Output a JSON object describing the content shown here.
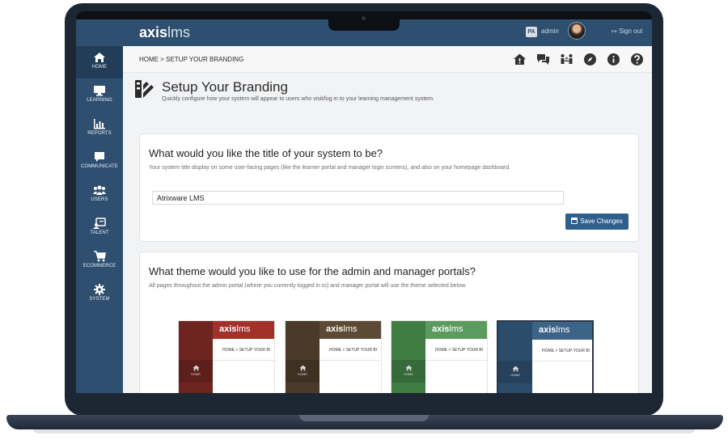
{
  "app": {
    "logo_bold": "axis",
    "logo_light": "lms",
    "user_initials": "PA",
    "user_name": "admin",
    "signout_label": "Sign out"
  },
  "sidebar": {
    "items": [
      {
        "label": "HOME",
        "icon": "home-icon",
        "active": true
      },
      {
        "label": "LEARNING",
        "icon": "monitor-icon"
      },
      {
        "label": "REPORTS",
        "icon": "bar-chart-icon"
      },
      {
        "label": "COMMUNICATE",
        "icon": "speech-bubble-icon"
      },
      {
        "label": "USERS",
        "icon": "users-icon"
      },
      {
        "label": "TALENT",
        "icon": "talent-icon"
      },
      {
        "label": "ECOMMERCE",
        "icon": "cart-icon"
      },
      {
        "label": "SYSTEM",
        "icon": "gear-icon"
      }
    ]
  },
  "breadcrumb": "HOME > SETUP YOUR BRANDING",
  "toolbar_icons": [
    "home-alert-icon",
    "chat-icon",
    "network-icon",
    "compass-icon",
    "info-icon",
    "help-icon"
  ],
  "page": {
    "title": "Setup Your Branding",
    "subtitle": "Quickly configure how your system will appear to users who visit/log in to your learning management system."
  },
  "title_section": {
    "heading": "What would you like the title of your system to be?",
    "description": "Your system title display on some user-facing pages (like the learner portal and manager login screens), and also on your homepage dashboard.",
    "input_value": "Atrixware LMS",
    "save_label": "Save Changes"
  },
  "theme_section": {
    "heading": "What theme would you like to use for the admin and manager portals?",
    "description": "All pages throughout the admin portal (where you currently logged in to) and manager portal will use the theme selected below.",
    "themes": [
      {
        "name": "red",
        "header": "#a2312a",
        "side": "#6e2520",
        "crumb": "HOME > SETUP YOUR BI",
        "home": "HOME",
        "selected": false
      },
      {
        "name": "brown",
        "header": "#5d4a34",
        "side": "#4a3a28",
        "crumb": "HOME > SETUP YOUR BI",
        "home": "HOME",
        "selected": false
      },
      {
        "name": "green",
        "header": "#5c9b5e",
        "side": "#3f7d42",
        "crumb": "HOME > SETUP YOUR BI",
        "home": "HOME",
        "selected": false
      },
      {
        "name": "blue",
        "header": "#3c6388",
        "side": "#2c4c6b",
        "crumb": "HOME > SETUP YOUR BI",
        "home": "HOME",
        "selected": true
      }
    ]
  },
  "colors": {
    "brand": "#2e4f6f",
    "button": "#2f5f8c"
  }
}
